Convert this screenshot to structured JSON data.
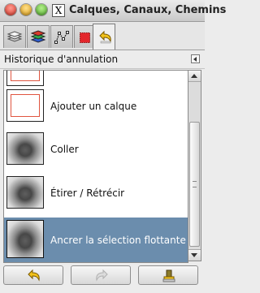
{
  "window": {
    "title": "Calques, Canaux, Chemins"
  },
  "tabs": [
    {
      "name": "layers-tab",
      "icon": "layers-icon"
    },
    {
      "name": "channels-tab",
      "icon": "channels-icon"
    },
    {
      "name": "paths-tab",
      "icon": "paths-icon"
    },
    {
      "name": "colormap-tab",
      "icon": "colormap-icon"
    },
    {
      "name": "undo-history-tab",
      "icon": "undo-icon",
      "active": true
    }
  ],
  "panel": {
    "title": "Historique d'annulation"
  },
  "history": {
    "items": [
      {
        "label": "",
        "thumbnail": "layer"
      },
      {
        "label": "Ajouter un calque",
        "thumbnail": "layer"
      },
      {
        "label": "Coller",
        "thumbnail": "photo"
      },
      {
        "label": "Étirer / Rétrécir",
        "thumbnail": "photo"
      },
      {
        "label": "Ancrer la sélection flottante",
        "thumbnail": "photo",
        "selected": true
      }
    ]
  },
  "buttons": {
    "undo": {
      "icon": "undo-arrow-icon",
      "enabled": true
    },
    "redo": {
      "icon": "redo-arrow-icon",
      "enabled": false
    },
    "clear": {
      "icon": "clear-history-icon",
      "enabled": true
    }
  },
  "colors": {
    "selection": "#6b8dad",
    "accent_red": "#e05540"
  }
}
